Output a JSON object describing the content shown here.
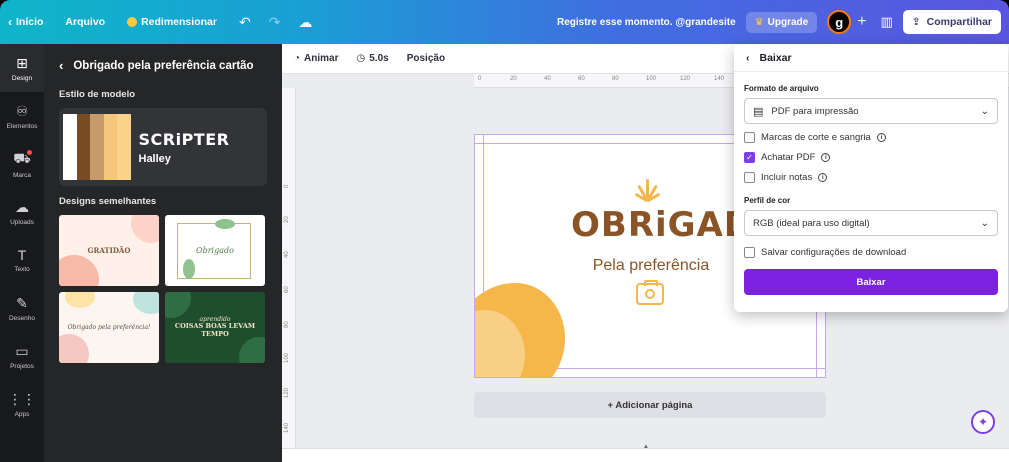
{
  "topbar": {
    "inicio": "Início",
    "arquivo": "Arquivo",
    "redimensionar": "Redimensionar",
    "message": "Registre esse momento. @grandesite",
    "upgrade": "Upgrade",
    "avatar_letter": "g",
    "compartilhar": "Compartilhar"
  },
  "rail": {
    "items": [
      {
        "label": "Design",
        "icon": "⊞"
      },
      {
        "label": "Elementos",
        "icon": "♾"
      },
      {
        "label": "Marca",
        "icon": "⛟"
      },
      {
        "label": "Uploads",
        "icon": "☁"
      },
      {
        "label": "Texto",
        "icon": "T"
      },
      {
        "label": "Desenho",
        "icon": "✎"
      },
      {
        "label": "Projetos",
        "icon": "▭"
      },
      {
        "label": "Apps",
        "icon": "⋮⋮"
      }
    ]
  },
  "panel": {
    "title": "Obrigado pela preferência cartão",
    "style_heading": "Estilo de modelo",
    "style_font1": "SCRiPTER",
    "style_font2": "Halley",
    "swatch_colors": [
      "#ffffff",
      "#7a4a22",
      "#c89a6a",
      "#f5c77a",
      "#fbd28a"
    ],
    "similar_heading": "Designs semelhantes",
    "thumbs": [
      {
        "title": "GRATIDÃO"
      },
      {
        "title": "Obrigado"
      },
      {
        "title": "Obrigado pela preferência!"
      },
      {
        "title_script": "aprendido",
        "title": "COISAS BOAS LEVAM TEMPO"
      }
    ]
  },
  "canvas": {
    "toolbar": {
      "animar": "Animar",
      "duration": "5.0s",
      "posicao": "Posição"
    },
    "ruler_top": [
      "0",
      "20",
      "40",
      "60",
      "80",
      "100",
      "120",
      "140"
    ],
    "ruler_left": [
      "0",
      "20",
      "40",
      "60",
      "80",
      "100",
      "120",
      "140",
      "160"
    ],
    "card": {
      "title": "OBRiGADO",
      "subtitle": "Pela preferência"
    },
    "add_page": "+ Adicionar página"
  },
  "download": {
    "title": "Baixar",
    "format_label": "Formato de arquivo",
    "format_value": "PDF para impressão",
    "options": [
      {
        "label": "Marcas de corte e sangria",
        "checked": false,
        "info": true
      },
      {
        "label": "Achatar PDF",
        "checked": true,
        "info": true
      },
      {
        "label": "Incluir notas",
        "checked": false,
        "info": true
      }
    ],
    "color_label": "Perfil de cor",
    "color_value": "RGB (ideal para uso digital)",
    "save_settings": "Salvar configurações de download",
    "button": "Baixar"
  },
  "colors": {
    "accent_purple": "#7b22e0",
    "card_brown": "#8a5426",
    "card_orange": "#f5b74a"
  }
}
